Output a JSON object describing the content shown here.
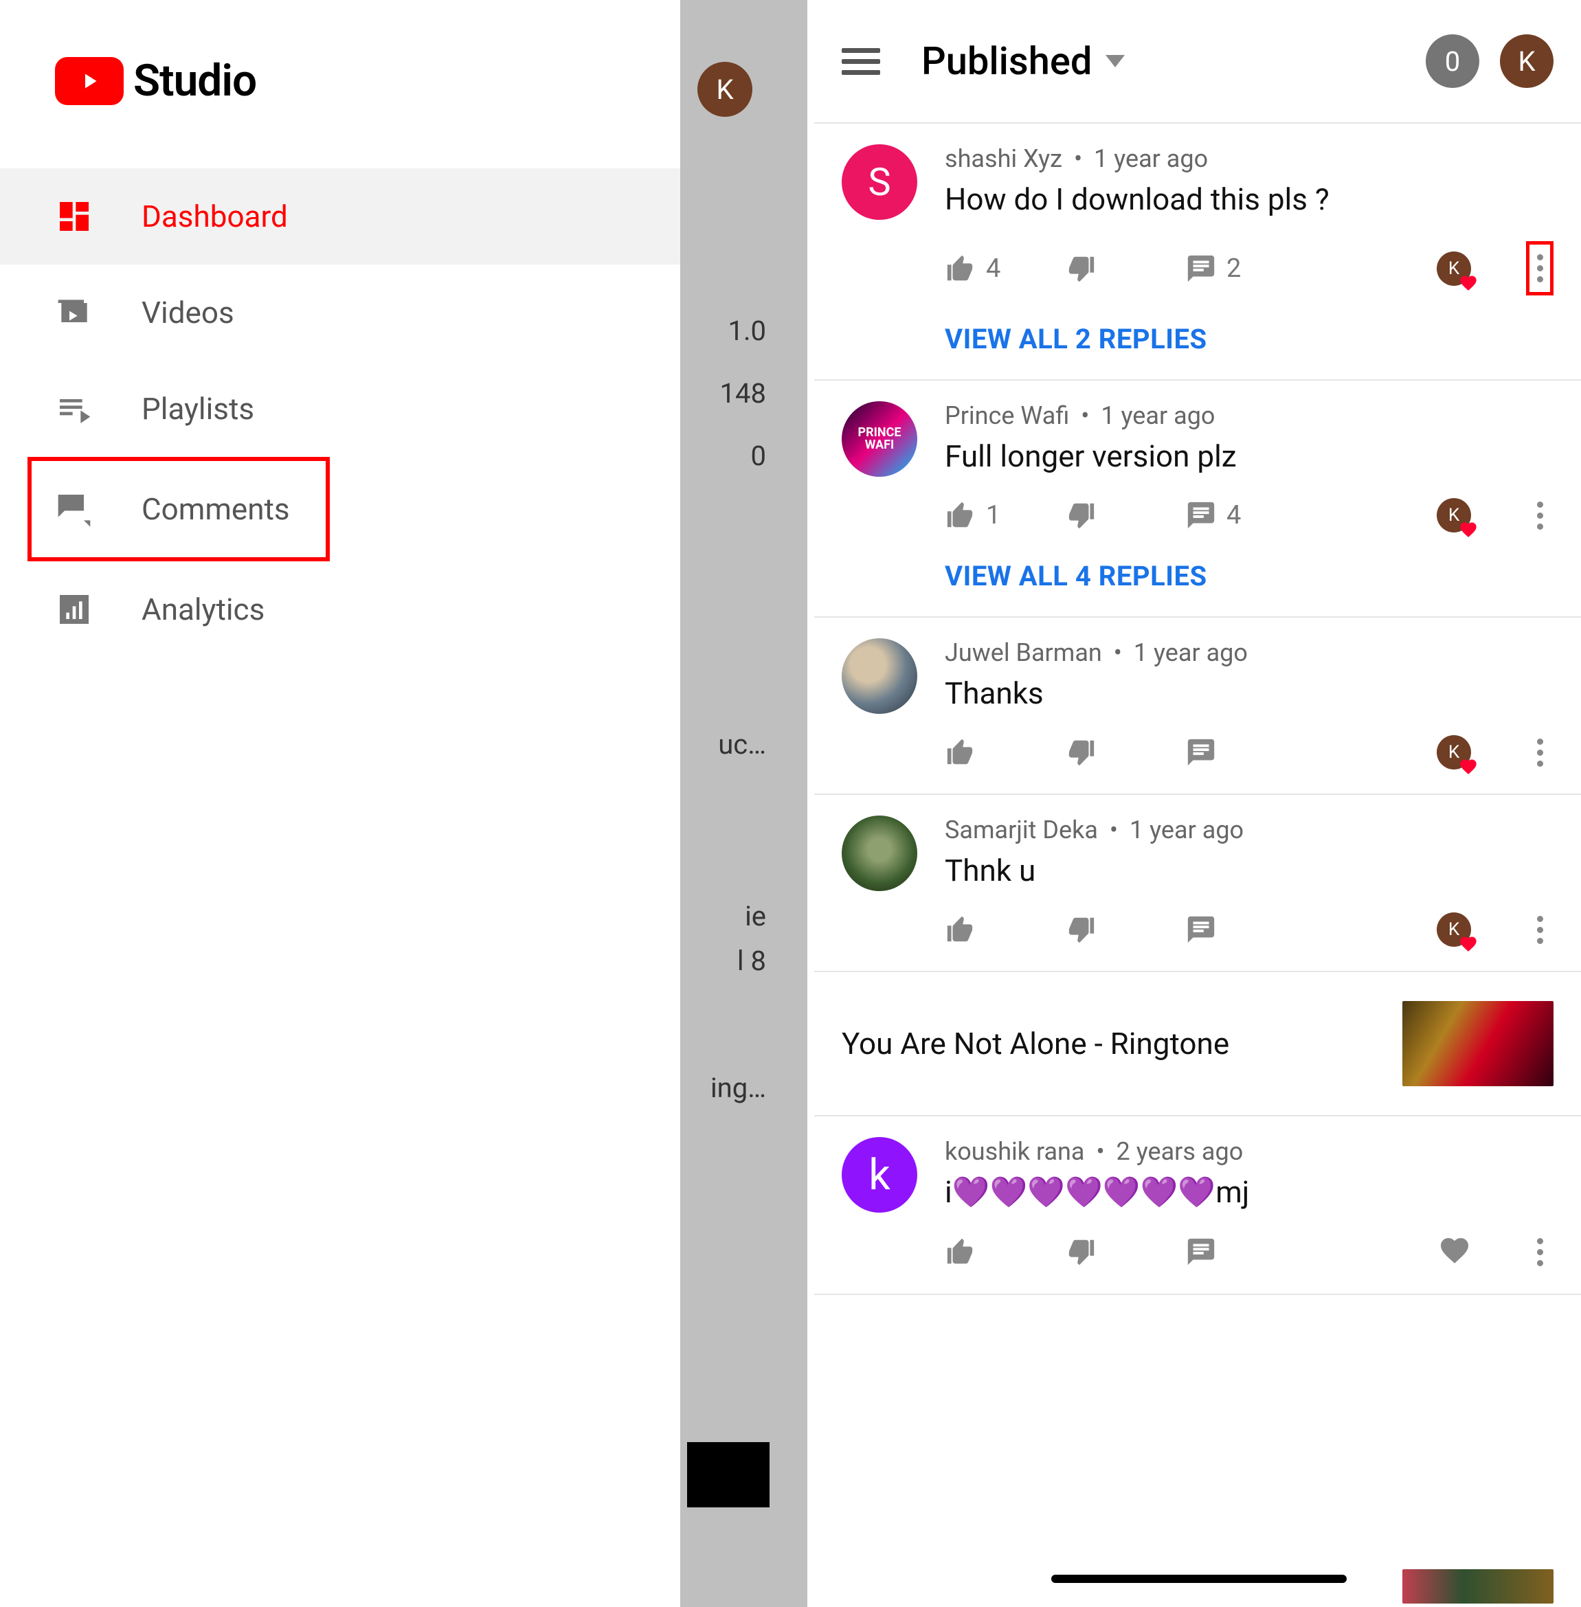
{
  "brand": {
    "text": "Studio"
  },
  "nav": {
    "dashboard": "Dashboard",
    "videos": "Videos",
    "playlists": "Playlists",
    "comments": "Comments",
    "analytics": "Analytics"
  },
  "backdrop": {
    "avatar": "K",
    "stat1": "1.0",
    "stat2": "148",
    "stat3": "0",
    "snip1": "uc…",
    "snip2": "ie",
    "snip3": "l 8",
    "snip4": "ing…"
  },
  "header": {
    "title": "Published",
    "count": "0",
    "avatar": "K"
  },
  "comments": [
    {
      "author": "shashi Xyz",
      "time": "1 year ago",
      "text": "How do I download this pls ?",
      "likes": "4",
      "replies": "2",
      "avatar_letter": "S",
      "avatar_class": "pink",
      "hearted": true,
      "view_all": "VIEW ALL 2 REPLIES",
      "more_boxed": true
    },
    {
      "author": "Prince Wafi",
      "time": "1 year ago",
      "text": "Full longer version plz",
      "likes": "1",
      "replies": "4",
      "avatar_letter": "PRINCE WAFI",
      "avatar_class": "wafi",
      "hearted": true,
      "view_all": "VIEW ALL 4 REPLIES",
      "more_boxed": false
    },
    {
      "author": "Juwel Barman",
      "time": "1 year ago",
      "text": "Thanks",
      "likes": "",
      "replies": "",
      "avatar_letter": "",
      "avatar_class": "photo1",
      "hearted": true,
      "view_all": "",
      "more_boxed": false
    },
    {
      "author": "Samarjit Deka",
      "time": "1 year ago",
      "text": "Thnk u",
      "likes": "",
      "replies": "",
      "avatar_letter": "",
      "avatar_class": "photo2",
      "hearted": true,
      "view_all": "",
      "more_boxed": false
    }
  ],
  "video_separator": {
    "title": "You Are Not Alone - Ringtone"
  },
  "comment5": {
    "author": "koushik rana",
    "time": "2 years ago",
    "text": "i💜💜💜💜💜💜💜mj",
    "avatar_letter": "k",
    "avatar_class": "purple"
  }
}
